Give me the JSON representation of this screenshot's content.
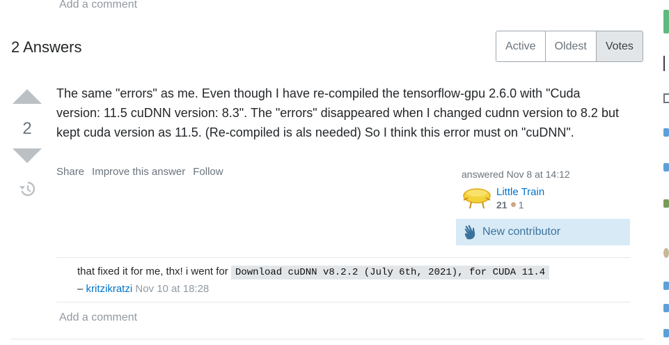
{
  "top_add_comment": "Add a comment",
  "answers_header": "2 Answers",
  "sort": {
    "tabs": [
      "Active",
      "Oldest",
      "Votes"
    ],
    "selected": "Votes"
  },
  "answer": {
    "votes": "2",
    "body": "The same \"errors\" as me. Even though I have re-compiled the tensorflow-gpu 2.6.0 with \"Cuda version: 11.5 cuDNN version: 8.3\". The \"errors\" disappeared when I changed cudnn version to 8.2 but kept cuda version as 11.5. (Re-compiled is als needed) So I think this error must on \"cuDNN\".",
    "menu": {
      "share": "Share",
      "improve": "Improve this answer",
      "follow": "Follow"
    },
    "answered": "answered Nov 8 at 14:12",
    "user": {
      "name": "Little Train",
      "reputation": "21",
      "bronze": "1"
    },
    "new_contributor": "New contributor"
  },
  "comment": {
    "text": "that fixed it for me, thx! i went for",
    "code": "Download cuDNN v8.2.2 (July 6th, 2021), for CUDA 11.4",
    "dash": "– ",
    "user": "kritzikratzi",
    "date": "Nov 10 at 18:28"
  },
  "add_comment": "Add a comment",
  "colors": {
    "link": "#0074cc",
    "new_contrib_bg": "#d9eaf7",
    "selected_tab": "#e3e6e8"
  }
}
